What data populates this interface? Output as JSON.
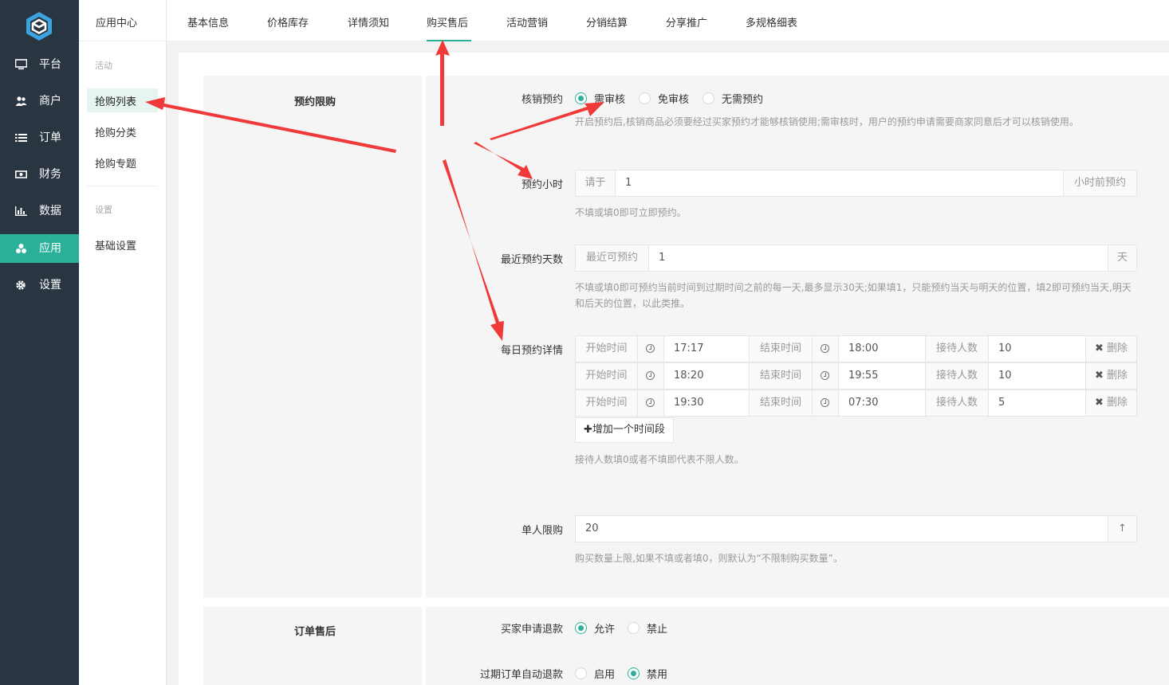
{
  "nav": {
    "items": [
      {
        "label": "平台",
        "icon": "monitor-icon"
      },
      {
        "label": "商户",
        "icon": "users-icon"
      },
      {
        "label": "订单",
        "icon": "list-icon"
      },
      {
        "label": "财务",
        "icon": "money-icon"
      },
      {
        "label": "数据",
        "icon": "bar-chart-icon"
      },
      {
        "label": "应用",
        "icon": "cubes-icon"
      },
      {
        "label": "设置",
        "icon": "gear-icon"
      }
    ],
    "active_index": 5,
    "accent": "#2bb199"
  },
  "side": {
    "title": "应用中心",
    "sections": [
      {
        "title": "活动",
        "items": [
          "抢购列表",
          "抢购分类",
          "抢购专题"
        ]
      },
      {
        "title": "设置",
        "items": [
          "基础设置"
        ]
      }
    ]
  },
  "tabs": [
    "基本信息",
    "价格库存",
    "详情须知",
    "购买售后",
    "活动营销",
    "分销结算",
    "分享推广",
    "多规格细表"
  ],
  "active_tab": 3,
  "reserve": {
    "section_title": "预约限购",
    "verify": {
      "label": "核销预约",
      "options": [
        "需审核",
        "免审核",
        "无需预约"
      ],
      "selected": 0,
      "hint": "开启预约后,核销商品必须要经过买家预约才能够核销使用;需审核时，用户的预约申请需要商家同意后才可以核销使用。"
    },
    "hours": {
      "label": "预约小时",
      "prefix": "请于",
      "value": "1",
      "suffix": "小时前预约",
      "hint": "不填或填0即可立即预约。"
    },
    "days": {
      "label": "最近预约天数",
      "prefix": "最近可预约",
      "value": "1",
      "suffix": "天",
      "hint": "不填或填0即可预约当前时间到过期时间之前的每一天,最多显示30天;如果填1，只能预约当天与明天的位置，填2即可预约当天,明天和后天的位置，以此类推。"
    },
    "daily": {
      "label": "每日预约详情",
      "start_label": "开始时间",
      "end_label": "结束时间",
      "count_label": "接待人数",
      "delete_label": "删除",
      "rows": [
        {
          "start": "17:17",
          "end": "18:00",
          "count": "10"
        },
        {
          "start": "18:20",
          "end": "19:55",
          "count": "10"
        },
        {
          "start": "19:30",
          "end": "07:30",
          "count": "5"
        }
      ],
      "add_button": "增加一个时间段",
      "hint": "接待人数填0或者不填即代表不限人数。"
    },
    "limit": {
      "label": "单人限购",
      "value": "20",
      "hint": "购买数量上限,如果不填或者填0，则默认为“不限制购买数量”。"
    }
  },
  "aftersale": {
    "section_title": "订单售后",
    "refund": {
      "label": "买家申请退款",
      "options": [
        "允许",
        "禁止"
      ],
      "selected": 0
    },
    "auto_refund": {
      "label": "过期订单自动退款",
      "options": [
        "启用",
        "禁用"
      ],
      "selected": 1
    }
  },
  "annotation_color": "#f03a3a"
}
